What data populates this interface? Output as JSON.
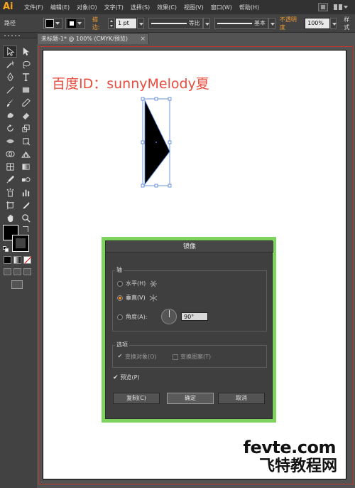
{
  "app": {
    "logo": "Ai"
  },
  "menu": {
    "items": [
      "文件(F)",
      "编辑(E)",
      "对象(O)",
      "文字(T)",
      "选择(S)",
      "效果(C)",
      "视图(V)",
      "窗口(W)",
      "帮助(H)"
    ]
  },
  "control_bar": {
    "object_type": "路径",
    "stroke_label": "描边:",
    "stroke_weight": "1 pt",
    "profile_label": "等比",
    "brush_label": "基本",
    "opacity_label": "不透明度",
    "opacity_value": "100%",
    "style_label": "样式"
  },
  "document_tab": {
    "title": "未标题-1* @ 100% (CMYK/预览)",
    "close": "×"
  },
  "artboard": {
    "watermark_top": "百度ID：sunnyMelody夏",
    "watermark_bottom_1": "fevte.com",
    "watermark_bottom_2": "飞特教程网"
  },
  "dialog": {
    "title": "镜像",
    "axis_group": "轴",
    "horizontal_label": "水平(H)",
    "vertical_label": "垂直(V)",
    "angle_label": "角度(A):",
    "angle_value": "90°",
    "options_group": "选项",
    "transform_objects": "变换对象(O)",
    "transform_patterns": "变换图案(T)",
    "preview_label": "预览(P)",
    "copy_button": "复制(C)",
    "ok_button": "确定",
    "cancel_button": "取消"
  },
  "colors": {
    "accent_orange": "#f08c2a",
    "dialog_highlight": "#7dd35e",
    "watermark_red": "#e84c3d",
    "selection_blue": "#4a7bd6"
  }
}
